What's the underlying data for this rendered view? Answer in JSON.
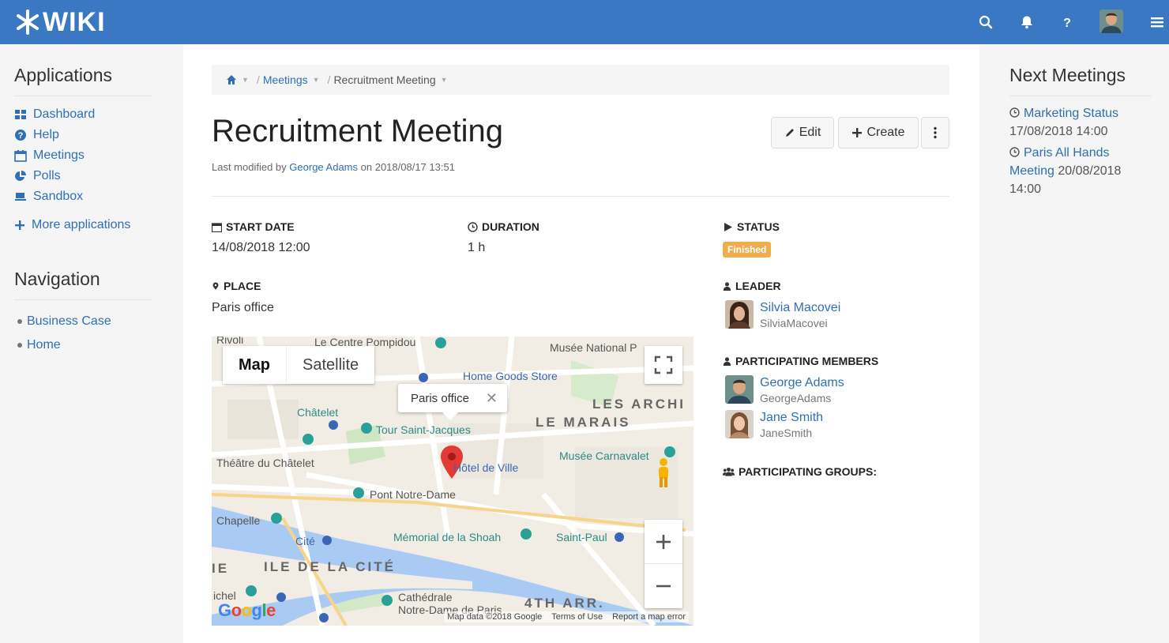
{
  "brand": {
    "name": "WIKI"
  },
  "colors": {
    "topbar": "#3a78c3",
    "link": "#2f6fb3",
    "status_badge": "#f0ad4e"
  },
  "topbar": {
    "icons": [
      "search-icon",
      "bell-icon",
      "question-icon",
      "avatar",
      "hamburger-icon"
    ]
  },
  "left": {
    "applications_title": "Applications",
    "apps": [
      {
        "label": "Dashboard",
        "icon": "dashboard-icon"
      },
      {
        "label": "Help",
        "icon": "help-icon"
      },
      {
        "label": "Meetings",
        "icon": "calendar-icon"
      },
      {
        "label": "Polls",
        "icon": "pie-chart-icon"
      },
      {
        "label": "Sandbox",
        "icon": "sandbox-icon"
      }
    ],
    "more_apps": "More applications",
    "navigation_title": "Navigation",
    "nav": [
      "Business Case",
      "Home"
    ]
  },
  "breadcrumb": {
    "items": [
      "Meetings",
      "Recruitment Meeting"
    ]
  },
  "page": {
    "title": "Recruitment Meeting",
    "last_modified_prefix": "Last modified by",
    "last_modified_user": "George Adams",
    "last_modified_on": "on 2018/08/17 13:51",
    "edit_label": "Edit",
    "create_label": "Create"
  },
  "fields": {
    "start_date_label": "START DATE",
    "start_date": "14/08/2018 12:00",
    "duration_label": "DURATION",
    "duration": "1 h",
    "status_label": "STATUS",
    "status": "Finished",
    "place_label": "PLACE",
    "place": "Paris office",
    "leader_label": "LEADER",
    "leader": {
      "name": "Silvia Macovei",
      "user": "SilviaMacovei"
    },
    "members_label": "PARTICIPATING MEMBERS",
    "members": [
      {
        "name": "George Adams",
        "user": "GeorgeAdams"
      },
      {
        "name": "Jane Smith",
        "user": "JaneSmith"
      }
    ],
    "groups_label": "PARTICIPATING GROUPS:"
  },
  "map": {
    "tab_map": "Map",
    "tab_satellite": "Satellite",
    "popup": "Paris office",
    "labels": {
      "rivoli": "Rivoli",
      "pompidou": "Le Centre Pompidou",
      "musee_national": "Musée National P",
      "home_goods": "Home Goods Store",
      "les_archi": "LES ARCHI",
      "le_marais": "LE MARAIS",
      "chatelet": "Châtelet",
      "tour_st_jacques": "Tour Saint-Jacques",
      "theatre": "Théâtre du Châtelet",
      "hotel_de_ville": "Hôtel de Ville",
      "carnavalet": "Musée Carnavalet",
      "pont_nd": "Pont Notre-Dame",
      "chapelle": "Chapelle",
      "cite": "Cité",
      "shoah": "Mémorial de la Shoah",
      "saint_paul": "Saint-Paul",
      "ile_cite": "ILE DE LA CITÉ",
      "cathedrale": "Cathédrale",
      "notre_dame": "Notre-Dame de Paris",
      "arr": "4TH ARR.",
      "ichel": "ichel",
      "ie": "IE"
    },
    "google": "Google",
    "map_data": "Map data ©2018 Google",
    "terms": "Terms of Use",
    "report": "Report a map error"
  },
  "right": {
    "title": "Next Meetings",
    "meetings": [
      {
        "name": "Marketing Status",
        "date": "17/08/2018 14:00"
      },
      {
        "name_line1": "Paris All Hands",
        "name_line2": "Meeting",
        "date_part1": "20/08/2018",
        "date_part2": "14:00"
      }
    ]
  }
}
